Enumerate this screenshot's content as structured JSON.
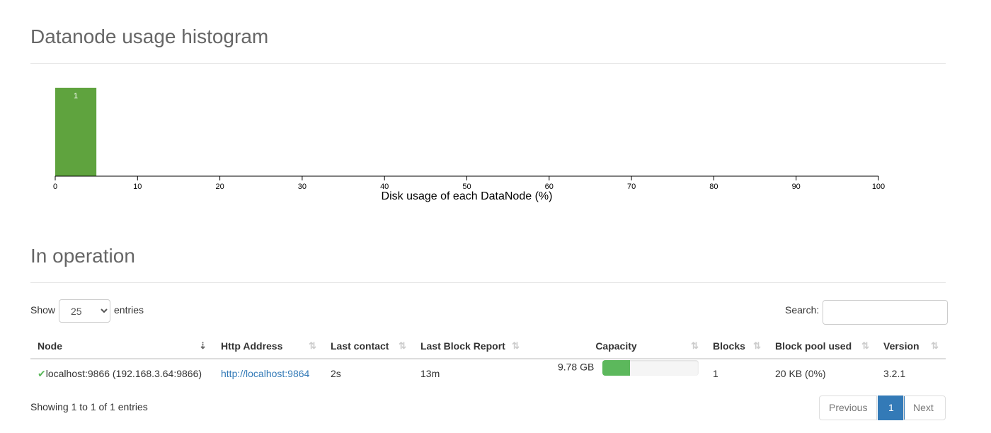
{
  "histogram": {
    "title": "Datanode usage histogram",
    "chart_data": {
      "type": "bar",
      "xlabel": "Disk usage of each DataNode (%)",
      "xlim": [
        0,
        100
      ],
      "ticks": [
        "0",
        "10",
        "20",
        "30",
        "40",
        "50",
        "60",
        "70",
        "80",
        "90",
        "100"
      ],
      "bins": [
        {
          "x0": 0,
          "x1": 5,
          "count": 1
        }
      ],
      "bar_color": "#5fa33e"
    }
  },
  "operation": {
    "title": "In operation",
    "show_label": "Show",
    "entries_label": "entries",
    "page_size": "25",
    "search_label": "Search:",
    "search_value": "",
    "columns": [
      "Node",
      "Http Address",
      "Last contact",
      "Last Block Report",
      "Capacity",
      "Blocks",
      "Block pool used",
      "Version"
    ],
    "rows": [
      {
        "node": "localhost:9866 (192.168.3.64:9866)",
        "http": "http://localhost:9864",
        "last_contact": "2s",
        "last_block_report": "13m",
        "capacity": "9.78 GB",
        "capacity_used_pct": 29,
        "blocks": "1",
        "block_pool_used": "20 KB (0%)",
        "version": "3.2.1"
      }
    ],
    "info": "Showing 1 to 1 of 1 entries",
    "pagination": {
      "previous": "Previous",
      "page": "1",
      "next": "Next"
    },
    "accent": "#337ab7",
    "ok_color": "#5cb85c"
  }
}
